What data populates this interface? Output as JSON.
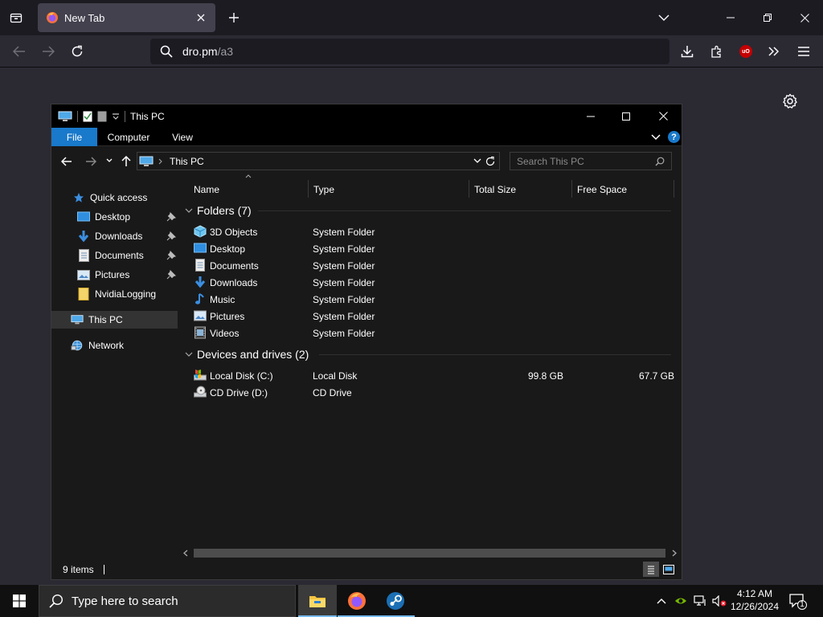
{
  "browser": {
    "tab": {
      "title": "New Tab",
      "favicon": "firefox-icon"
    },
    "url": {
      "host": "dro.pm",
      "path": "/a3"
    },
    "accent": "#1c1b22"
  },
  "explorer": {
    "title": "This PC",
    "ribbon_tabs": [
      "File",
      "Computer",
      "View"
    ],
    "address": "This PC",
    "search_placeholder": "Search This PC",
    "nav": {
      "quick_access": "Quick access",
      "items": [
        {
          "label": "Desktop",
          "icon": "desktop-icon",
          "pinned": true
        },
        {
          "label": "Downloads",
          "icon": "downloads-icon",
          "pinned": true
        },
        {
          "label": "Documents",
          "icon": "documents-icon",
          "pinned": true
        },
        {
          "label": "Pictures",
          "icon": "pictures-icon",
          "pinned": true
        },
        {
          "label": "NvidiaLogging",
          "icon": "folder-icon",
          "pinned": false
        }
      ],
      "this_pc": "This PC",
      "network": "Network"
    },
    "columns": [
      "Name",
      "Type",
      "Total Size",
      "Free Space"
    ],
    "folders_group": "Folders (7)",
    "folders": [
      {
        "name": "3D Objects",
        "type": "System Folder",
        "icon": "3d-objects-icon"
      },
      {
        "name": "Desktop",
        "type": "System Folder",
        "icon": "desktop-icon"
      },
      {
        "name": "Documents",
        "type": "System Folder",
        "icon": "documents-icon"
      },
      {
        "name": "Downloads",
        "type": "System Folder",
        "icon": "downloads-icon"
      },
      {
        "name": "Music",
        "type": "System Folder",
        "icon": "music-icon"
      },
      {
        "name": "Pictures",
        "type": "System Folder",
        "icon": "pictures-icon"
      },
      {
        "name": "Videos",
        "type": "System Folder",
        "icon": "videos-icon"
      }
    ],
    "drives_group": "Devices and drives (2)",
    "drives": [
      {
        "name": "Local Disk (C:)",
        "type": "Local Disk",
        "total": "99.8 GB",
        "free": "67.7 GB",
        "icon": "local-disk-icon"
      },
      {
        "name": "CD Drive (D:)",
        "type": "CD Drive",
        "total": "",
        "free": "",
        "icon": "cd-drive-icon"
      }
    ],
    "status": "9 items"
  },
  "taskbar": {
    "search_placeholder": "Type here to search",
    "time": "4:12 AM",
    "date": "12/26/2024",
    "notification_count": "1"
  }
}
